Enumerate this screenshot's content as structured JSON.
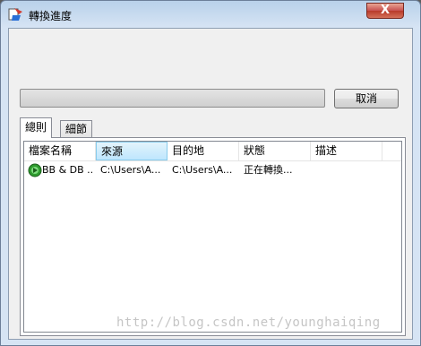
{
  "window": {
    "title": "轉換進度",
    "close_label": "X"
  },
  "progress": {
    "value": 0
  },
  "buttons": {
    "cancel": "取消"
  },
  "tabs": [
    {
      "label": "總則"
    },
    {
      "label": "細節"
    }
  ],
  "list": {
    "columns": [
      "檔案名稱",
      "來源",
      "目的地",
      "狀態",
      "描述"
    ],
    "rows": [
      {
        "name": "BB & DB ...",
        "source": "C:\\Users\\A...",
        "dest": "C:\\Users\\A...",
        "status": "正在轉換...",
        "desc": ""
      }
    ]
  },
  "watermark": "http://blog.csdn.net/younghaiqing"
}
